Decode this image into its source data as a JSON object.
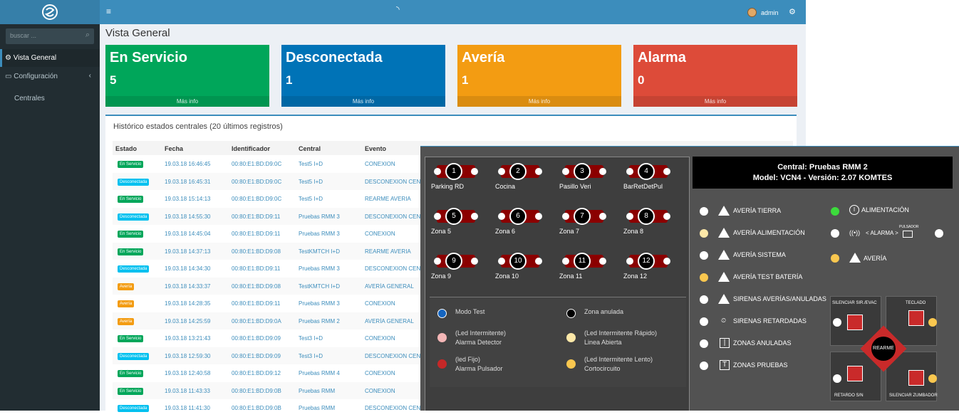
{
  "sidebar": {
    "search_placeholder": "buscar ...",
    "items": [
      {
        "label": "Vista General"
      },
      {
        "label": "Configuración"
      },
      {
        "label": "Centrales"
      }
    ]
  },
  "header": {
    "user": "admin"
  },
  "page": {
    "title": "Vista General"
  },
  "boxes": [
    {
      "title": "En Servicio",
      "count": "5",
      "more": "Más info",
      "color": "#00a65a"
    },
    {
      "title": "Desconectada",
      "count": "1",
      "more": "Más info",
      "color": "#0073b7"
    },
    {
      "title": "Avería",
      "count": "1",
      "more": "Más info",
      "color": "#f39c12"
    },
    {
      "title": "Alarma",
      "count": "0",
      "more": "Más info",
      "color": "#dd4b39"
    }
  ],
  "history": {
    "title": "Histórico estados centrales (20 últimos registros)",
    "headers": [
      "Estado",
      "Fecha",
      "Identificador",
      "Central",
      "Evento"
    ],
    "rows": [
      {
        "estado": "En Servicio",
        "fecha": "19.03.18 16:46:45",
        "id": "00:80:E1:BD:D9:0C",
        "central": "Test5 I+D",
        "evento": "CONEXION"
      },
      {
        "estado": "Desconectada",
        "fecha": "19.03.18 16:45:31",
        "id": "00:80:E1:BD:D9:0C",
        "central": "Test5 I+D",
        "evento": "DESCONEXION CENT"
      },
      {
        "estado": "En Servicio",
        "fecha": "19.03.18 15:14:13",
        "id": "00:80:E1:BD:D9:0C",
        "central": "Test5 I+D",
        "evento": "REARME AVERIA"
      },
      {
        "estado": "Desconectada",
        "fecha": "19.03.18 14:55:30",
        "id": "00:80:E1:BD:D9:11",
        "central": "Pruebas RMM 3",
        "evento": "DESCONEXION CENT"
      },
      {
        "estado": "En Servicio",
        "fecha": "19.03.18 14:45:04",
        "id": "00:80:E1:BD:D9:11",
        "central": "Pruebas RMM 3",
        "evento": "CONEXION"
      },
      {
        "estado": "En Servicio",
        "fecha": "19.03.18 14:37:13",
        "id": "00:80:E1:BD:D9:08",
        "central": "TestKMTCH I+D",
        "evento": "REARME AVERIA"
      },
      {
        "estado": "Desconectada",
        "fecha": "19.03.18 14:34:30",
        "id": "00:80:E1:BD:D9:11",
        "central": "Pruebas RMM 3",
        "evento": "DESCONEXION CENT"
      },
      {
        "estado": "Avería",
        "fecha": "19.03.18 14:33:37",
        "id": "00:80:E1:BD:D9:08",
        "central": "TestKMTCH I+D",
        "evento": "AVERÍA GENERAL"
      },
      {
        "estado": "Avería",
        "fecha": "19.03.18 14:28:35",
        "id": "00:80:E1:BD:D9:11",
        "central": "Pruebas RMM 3",
        "evento": "CONEXION"
      },
      {
        "estado": "Avería",
        "fecha": "19.03.18 14:25:59",
        "id": "00:80:E1:BD:D9:0A",
        "central": "Pruebas RMM 2",
        "evento": "AVERÍA GENERAL"
      },
      {
        "estado": "En Servicio",
        "fecha": "19.03.18 13:21:43",
        "id": "00:80:E1:BD:D9:09",
        "central": "Test3 I+D",
        "evento": "CONEXION"
      },
      {
        "estado": "Desconectada",
        "fecha": "19.03.18 12:59:30",
        "id": "00:80:E1:BD:D9:09",
        "central": "Test3 I+D",
        "evento": "DESCONEXION CENT"
      },
      {
        "estado": "En Servicio",
        "fecha": "19.03.18 12:40:58",
        "id": "00:80:E1:BD:D9:12",
        "central": "Pruebas RMM 4",
        "evento": "CONEXION"
      },
      {
        "estado": "En Servicio",
        "fecha": "19.03.18 11:43:33",
        "id": "00:80:E1:BD:D9:0B",
        "central": "Pruebas RMM",
        "evento": "CONEXION"
      },
      {
        "estado": "Desconectada",
        "fecha": "19.03.18 11:41:30",
        "id": "00:80:E1:BD:D9:0B",
        "central": "Pruebas RMM",
        "evento": "DESCONEXION CENT"
      }
    ]
  },
  "panel": {
    "zones": [
      {
        "n": "1",
        "label": "Parking RD"
      },
      {
        "n": "2",
        "label": "Cocina"
      },
      {
        "n": "3",
        "label": "Pasillo Veri"
      },
      {
        "n": "4",
        "label": "BarRetDetPul"
      },
      {
        "n": "5",
        "label": "Zona 5"
      },
      {
        "n": "6",
        "label": "Zona 6"
      },
      {
        "n": "7",
        "label": "Zona 7"
      },
      {
        "n": "8",
        "label": "Zona 8"
      },
      {
        "n": "9",
        "label": "Zona 9"
      },
      {
        "n": "10",
        "label": "Zona 10"
      },
      {
        "n": "11",
        "label": "Zona 11"
      },
      {
        "n": "12",
        "label": "Zona 12"
      }
    ],
    "legend": {
      "modo_test": "Modo Test",
      "zona_anulada": "Zona anulada",
      "alarma_detector_1": "(Led Intermitente)",
      "alarma_detector_2": "Alarma Detector",
      "linea_abierta_1": "(Led Intermitente Rápido)",
      "linea_abierta_2": "Linea Abierta",
      "alarma_pulsador_1": "(led Fijo)",
      "alarma_pulsador_2": "Alarma Pulsador",
      "cortocircuito_1": "(Led Intermitente Lento)",
      "cortocircuito_2": "Cortocircuito"
    },
    "lcd_line1": "Central: Pruebas RMM 2",
    "lcd_line2": "Model: VCN4 - Versión: 2.07 KOMTES",
    "status": [
      "AVERÍA TIERRA",
      "AVERÍA ALIMENTACIÓN",
      "AVERÍA SISTEMA",
      "AVERÍA TEST BATERÍA",
      "SIRENAS AVERÍAS/ANULADAS",
      "SIRENAS RETARDADAS",
      "ZONAS ANULADAS",
      "ZONAS PRUEBAS"
    ],
    "alimentacion": "ALIMENTACIÓN",
    "alarma": "< ALARMA >",
    "pulsador": "PULSADOR",
    "averia": "AVERÍA",
    "silenciar_sir": "SILENCIAR SIR./EVAC",
    "teclado": "TECLADO",
    "rearme": "REARME",
    "retardo": "RETARDO S/N",
    "silenciar_zumbador": "SILENCIAR ZUMBADOR"
  }
}
